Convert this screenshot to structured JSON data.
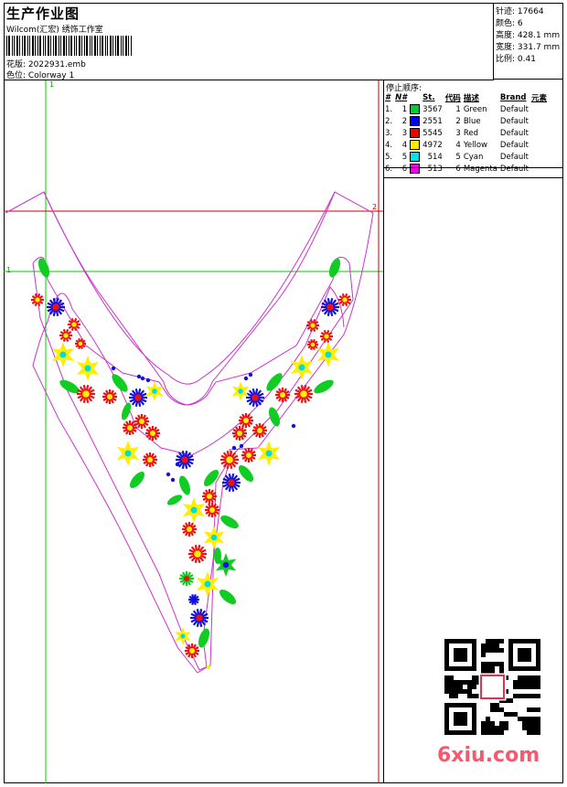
{
  "header": {
    "title": "生产作业图",
    "subtitle": "Wilcom(汇宏) 绣饰工作室",
    "design_file_label": "花版:",
    "design_file": "2022931.emb",
    "colorway_label": "色位:",
    "colorway": "Colorway 1"
  },
  "stats": {
    "stitches_label": "针迹:",
    "stitches": "17664",
    "colors_label": "颜色:",
    "colors": "6",
    "height_label": "高度:",
    "height": "428.1 mm",
    "width_label": "宽度:",
    "width": "331.7 mm",
    "scale_label": "比例:",
    "scale": "0.41"
  },
  "stop_sequence": {
    "title": "停止顺序:",
    "headers": [
      "#",
      "N#",
      "St.",
      "代码",
      "描述",
      "Brand",
      "元素"
    ],
    "rows": [
      {
        "idx": "1.",
        "n": "1",
        "st": "3567",
        "code": "1",
        "desc": "Green",
        "brand": "Default",
        "color": "#00cc33"
      },
      {
        "idx": "2.",
        "n": "2",
        "st": "2551",
        "code": "2",
        "desc": "Blue",
        "brand": "Default",
        "color": "#0000ee"
      },
      {
        "idx": "3.",
        "n": "3",
        "st": "5545",
        "code": "3",
        "desc": "Red",
        "brand": "Default",
        "color": "#ee0000"
      },
      {
        "idx": "4.",
        "n": "4",
        "st": "4972",
        "code": "4",
        "desc": "Yellow",
        "brand": "Default",
        "color": "#ffee00"
      },
      {
        "idx": "5.",
        "n": "5",
        "st": "514",
        "code": "5",
        "desc": "Cyan",
        "brand": "Default",
        "color": "#00e5e5"
      },
      {
        "idx": "6.",
        "n": "6",
        "st": "513",
        "code": "6",
        "desc": "Magenta",
        "brand": "Default",
        "color": "#ee00ee"
      }
    ]
  },
  "guides": {
    "vertical_label": "1",
    "horizontal_label_1": "1",
    "horizontal_label_2": "2"
  },
  "watermark": "6xiu.com",
  "colors": {
    "guide_green": "#00cc00",
    "guide_red": "#cc0000",
    "outline_magenta": "#cc33cc",
    "watermark_pink": "#f25a6e"
  }
}
